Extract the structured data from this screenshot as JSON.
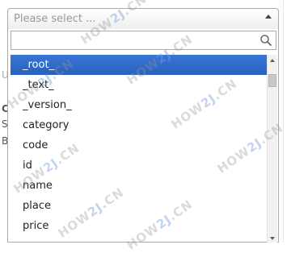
{
  "background": {
    "fragments": [
      "U",
      "C",
      "S",
      "B"
    ]
  },
  "select": {
    "placeholder": "Please select ..."
  },
  "search": {
    "value": "",
    "placeholder": ""
  },
  "options": [
    "_root_",
    "_text_",
    "_version_",
    "category",
    "code",
    "id",
    "name",
    "place",
    "price"
  ],
  "highlighted_index": 0,
  "watermark": {
    "prefix": "HOW",
    "middle": "2J",
    "suffix": ".CN"
  },
  "colors": {
    "highlight": "#3875d7",
    "border": "#aaaaaa"
  }
}
